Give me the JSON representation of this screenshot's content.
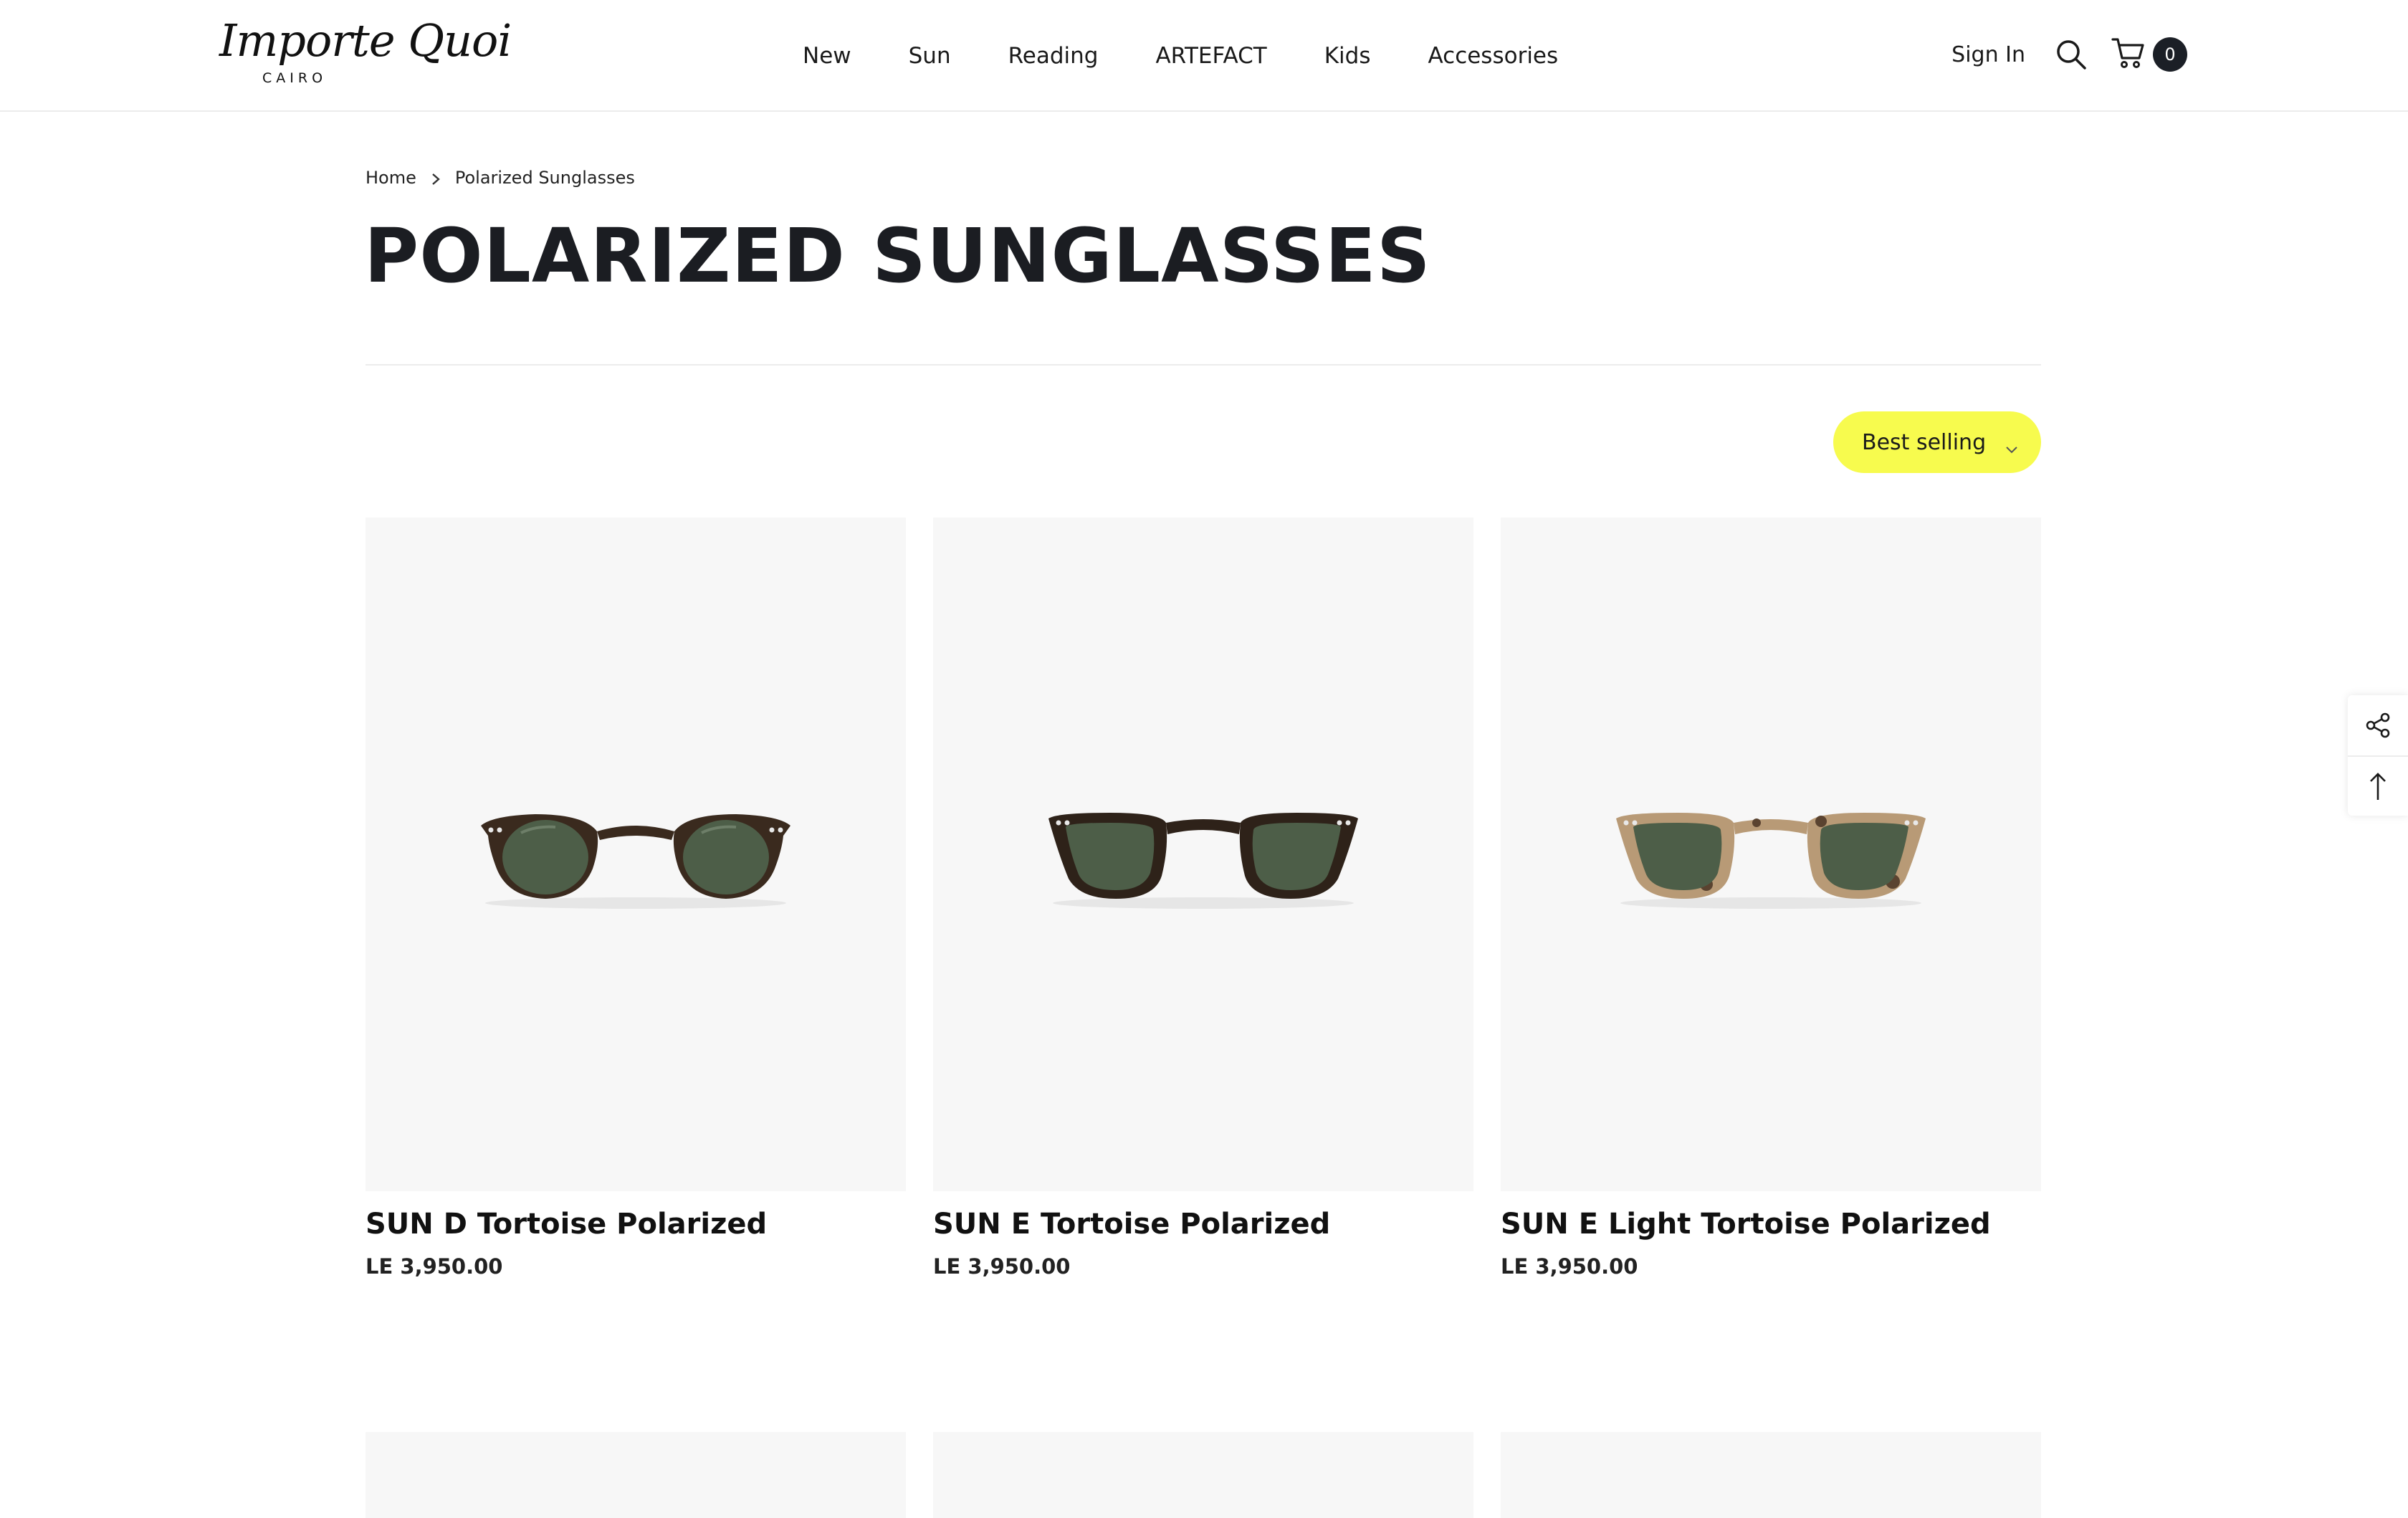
{
  "header": {
    "logo_text": "Importe Quoi",
    "logo_city": "CAIRO",
    "nav": [
      "New",
      "Sun",
      "Reading",
      "ARTEFACT",
      "Kids",
      "Accessories"
    ],
    "sign_in": "Sign In",
    "cart_count": "0"
  },
  "breadcrumb": {
    "home": "Home",
    "current": "Polarized Sunglasses"
  },
  "page_title": "POLARIZED SUNGLASSES",
  "sort": {
    "selected": "Best selling"
  },
  "products": [
    {
      "title": "SUN D Tortoise Polarized",
      "price": "LE 3,950.00",
      "frame_style": "round",
      "frame_color": "#3a2a1e",
      "lens_color": "#4d5e48"
    },
    {
      "title": "SUN E Tortoise Polarized",
      "price": "LE 3,950.00",
      "frame_style": "square",
      "frame_color": "#2e2219",
      "lens_color": "#4d5e48"
    },
    {
      "title": "SUN E Light Tortoise Polarized",
      "price": "LE 3,950.00",
      "frame_style": "square",
      "frame_color": "#b89a76",
      "lens_color": "#4d5e48"
    }
  ],
  "colors": {
    "accent_sort_bg": "#f7fb4e",
    "cart_badge_bg": "#1b1f26",
    "image_bg": "#f7f7f7"
  }
}
